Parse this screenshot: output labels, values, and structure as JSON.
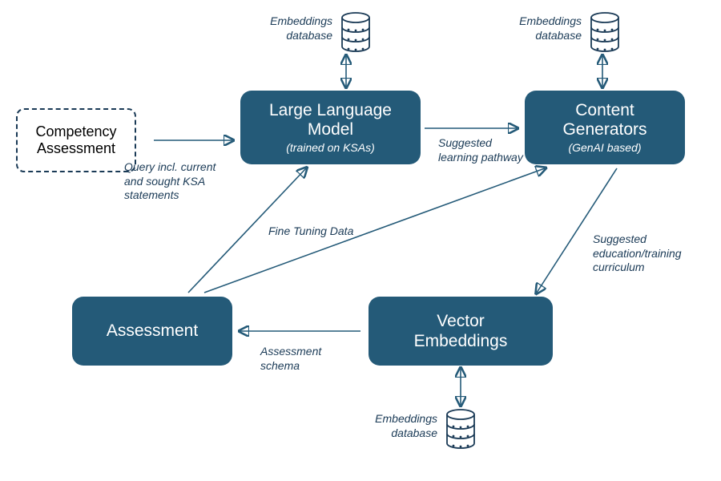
{
  "nodes": {
    "competency": "Competency Assessment",
    "llm": {
      "title": "Large Language Model",
      "sub": "(trained on KSAs)"
    },
    "content": {
      "title": "Content Generators",
      "sub": "(GenAI based)"
    },
    "assessment": "Assessment",
    "vector": "Vector Embeddings"
  },
  "edges": {
    "query": "Query incl. current and sought KSA statements",
    "pathway": "Suggested learning pathway",
    "finetune": "Fine Tuning Data",
    "schema": "Assessment schema",
    "curriculum": "Suggested education/training curriculum"
  },
  "db_label": "Embeddings database"
}
